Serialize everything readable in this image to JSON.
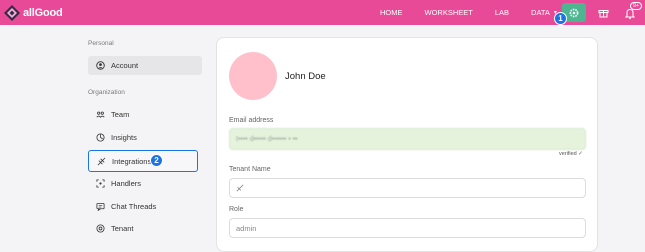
{
  "brand": {
    "name": "allGood"
  },
  "nav": {
    "items": [
      {
        "label": "HOME"
      },
      {
        "label": "WORKSHEET"
      },
      {
        "label": "LAB"
      },
      {
        "label": "DATA"
      }
    ],
    "notifications_badge": "9+"
  },
  "markers": {
    "first": "1",
    "second": "2"
  },
  "sidebar": {
    "personal_label": "Personal",
    "organization_label": "Organization",
    "items": [
      {
        "label": "Account",
        "icon": "user-circle-icon"
      },
      {
        "label": "Team",
        "icon": "team-icon"
      },
      {
        "label": "Insights",
        "icon": "insights-icon"
      },
      {
        "label": "Integrations",
        "icon": "integrations-icon"
      },
      {
        "label": "Handlers",
        "icon": "handlers-icon"
      },
      {
        "label": "Chat Threads",
        "icon": "chat-icon"
      },
      {
        "label": "Tenant",
        "icon": "tenant-icon"
      }
    ]
  },
  "profile": {
    "name": "John Doe",
    "email_label": "Email address",
    "email_value": "t•••• d••••• d•••••• • ••",
    "verified_text": "verified ✓",
    "tenant_label": "Tenant Name",
    "tenant_value": "",
    "role_label": "Role",
    "role_value": "admin"
  },
  "colors": {
    "topbar": "#e84a98",
    "settings_button": "#4db690",
    "marker": "#1a73e8",
    "email_bg": "#e5f3dd",
    "avatar": "#ffc0cb"
  }
}
